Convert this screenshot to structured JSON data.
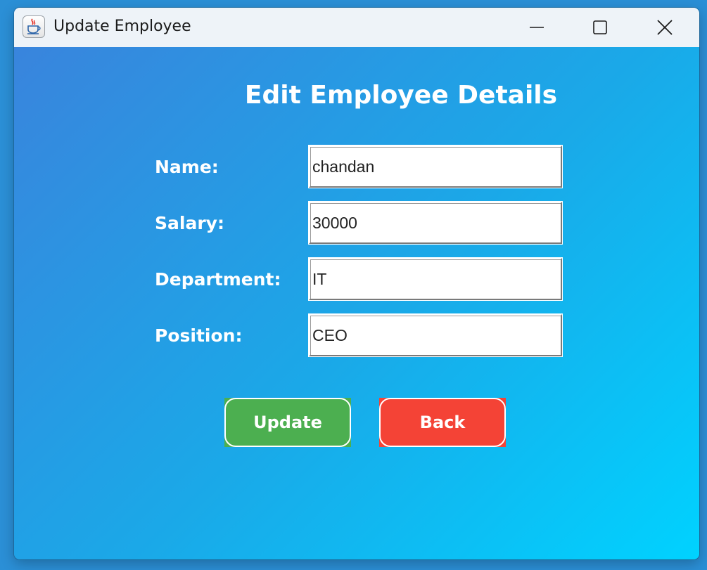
{
  "window": {
    "title": "Update Employee",
    "icons": {
      "app": "java-coffee-cup-icon",
      "minimize": "minimize-icon",
      "maximize": "maximize-icon",
      "close": "close-icon"
    }
  },
  "form": {
    "heading": "Edit Employee Details",
    "fields": [
      {
        "label": "Name:",
        "value": "chandan"
      },
      {
        "label": "Salary:",
        "value": "30000"
      },
      {
        "label": "Department:",
        "value": "IT"
      },
      {
        "label": "Position:",
        "value": "CEO"
      }
    ]
  },
  "actions": {
    "update_label": "Update",
    "back_label": "Back"
  },
  "colors": {
    "gradient_start": "#3b82dc",
    "gradient_end": "#00d2ff",
    "update_button": "#4caf50",
    "back_button": "#f44336",
    "titlebar": "#eef3f8"
  }
}
